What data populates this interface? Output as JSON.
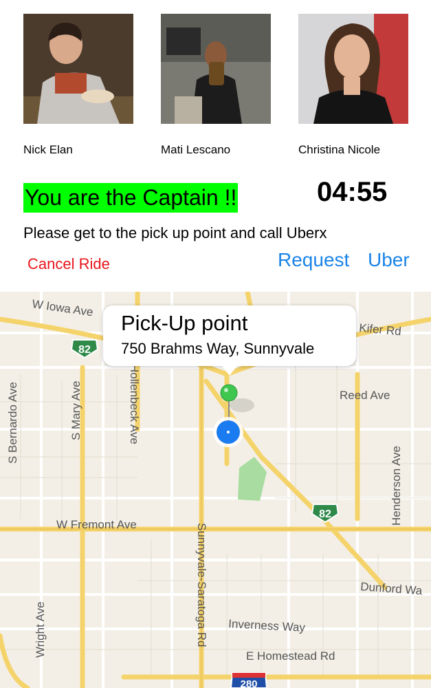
{
  "riders": [
    {
      "name": "Nick Elan"
    },
    {
      "name": "Mati Lescano"
    },
    {
      "name": "Christina Nicole"
    }
  ],
  "status": {
    "captain_text": "You are the Captain !!",
    "timer": "04:55",
    "instruction": "Please get to the pick up point and call Uberx"
  },
  "actions": {
    "cancel_label": "Cancel Ride",
    "request_label": "Request",
    "uber_label": "Uber"
  },
  "map": {
    "callout_title": "Pick-Up point",
    "callout_address": "750 Brahms Way, Sunnyvale",
    "streets": {
      "iowa": "W Iowa Ave",
      "kifer": "Kifer Rd",
      "reed": "Reed Ave",
      "bernardo": "S Bernardo Ave",
      "mary": "S Mary Ave",
      "hollenbeck": "Hollenbeck Ave",
      "henderson": "Henderson Ave",
      "fremont": "W Fremont Ave",
      "sunnyvale_saratoga": "Sunnyvale-Saratoga Rd",
      "dunford": "Dunford Wa",
      "inverness": "Inverness Way",
      "wright": "Wright Ave",
      "homestead": "E Homestead Rd"
    },
    "highway_82": "82",
    "highway_280": "280",
    "colors": {
      "pin": "#3fc64f",
      "location": "#1a7cf0",
      "highlight": "#00ff00",
      "link": "#1a84e8",
      "cancel": "#e8141b"
    }
  }
}
